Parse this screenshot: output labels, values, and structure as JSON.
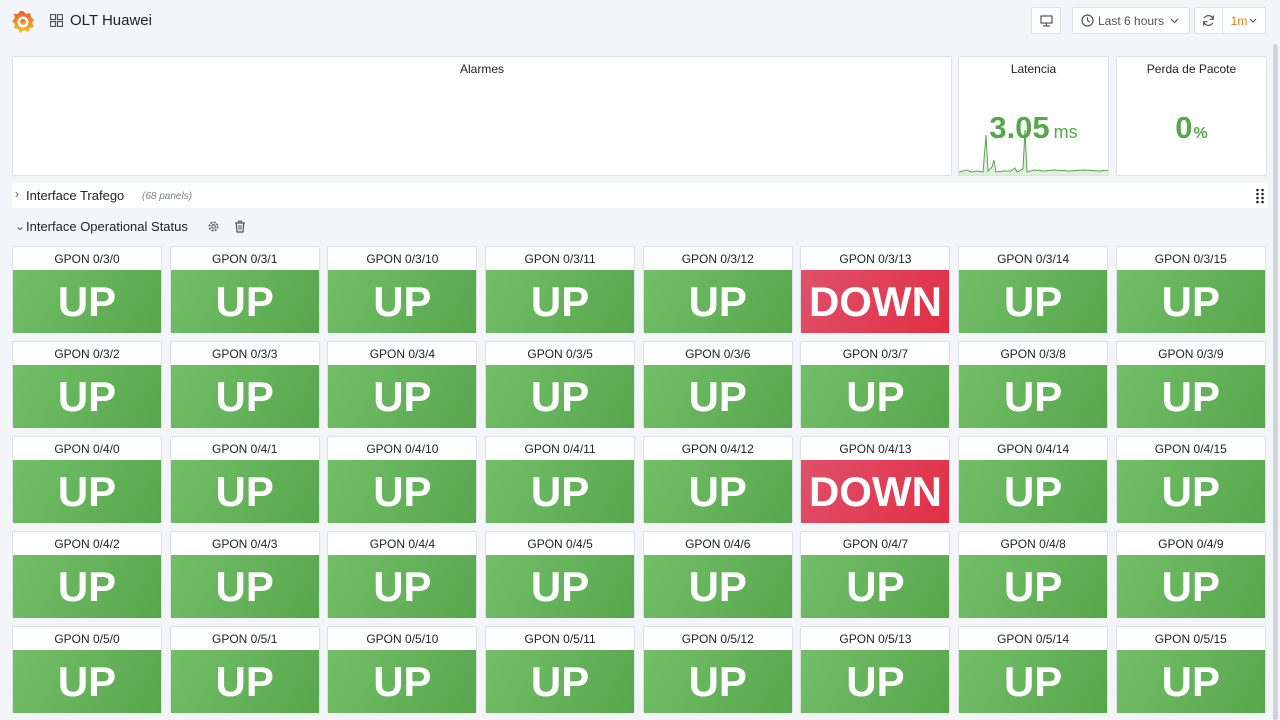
{
  "header": {
    "title": "OLT Huawei",
    "time_range_label": "Last 6 hours",
    "refresh_interval": "1m"
  },
  "panels": {
    "alarmes": {
      "title": "Alarmes"
    },
    "latencia": {
      "title": "Latencia",
      "value": "3.05",
      "unit": "ms"
    },
    "perda": {
      "title": "Perda de Pacote",
      "value": "0",
      "unit": "%"
    }
  },
  "rows": {
    "trafego": {
      "title": "Interface Trafego",
      "count": "(68 panels)"
    },
    "status": {
      "title": "Interface Operational Status"
    }
  },
  "tiles": [
    {
      "name": "GPON 0/3/0",
      "status": "UP"
    },
    {
      "name": "GPON 0/3/1",
      "status": "UP"
    },
    {
      "name": "GPON 0/3/10",
      "status": "UP"
    },
    {
      "name": "GPON 0/3/11",
      "status": "UP"
    },
    {
      "name": "GPON 0/3/12",
      "status": "UP"
    },
    {
      "name": "GPON 0/3/13",
      "status": "DOWN"
    },
    {
      "name": "GPON 0/3/14",
      "status": "UP"
    },
    {
      "name": "GPON 0/3/15",
      "status": "UP"
    },
    {
      "name": "GPON 0/3/2",
      "status": "UP"
    },
    {
      "name": "GPON 0/3/3",
      "status": "UP"
    },
    {
      "name": "GPON 0/3/4",
      "status": "UP"
    },
    {
      "name": "GPON 0/3/5",
      "status": "UP"
    },
    {
      "name": "GPON 0/3/6",
      "status": "UP"
    },
    {
      "name": "GPON 0/3/7",
      "status": "UP"
    },
    {
      "name": "GPON 0/3/8",
      "status": "UP"
    },
    {
      "name": "GPON 0/3/9",
      "status": "UP"
    },
    {
      "name": "GPON 0/4/0",
      "status": "UP"
    },
    {
      "name": "GPON 0/4/1",
      "status": "UP"
    },
    {
      "name": "GPON 0/4/10",
      "status": "UP"
    },
    {
      "name": "GPON 0/4/11",
      "status": "UP"
    },
    {
      "name": "GPON 0/4/12",
      "status": "UP"
    },
    {
      "name": "GPON 0/4/13",
      "status": "DOWN"
    },
    {
      "name": "GPON 0/4/14",
      "status": "UP"
    },
    {
      "name": "GPON 0/4/15",
      "status": "UP"
    },
    {
      "name": "GPON 0/4/2",
      "status": "UP"
    },
    {
      "name": "GPON 0/4/3",
      "status": "UP"
    },
    {
      "name": "GPON 0/4/4",
      "status": "UP"
    },
    {
      "name": "GPON 0/4/5",
      "status": "UP"
    },
    {
      "name": "GPON 0/4/6",
      "status": "UP"
    },
    {
      "name": "GPON 0/4/7",
      "status": "UP"
    },
    {
      "name": "GPON 0/4/8",
      "status": "UP"
    },
    {
      "name": "GPON 0/4/9",
      "status": "UP"
    },
    {
      "name": "GPON 0/5/0",
      "status": "UP"
    },
    {
      "name": "GPON 0/5/1",
      "status": "UP"
    },
    {
      "name": "GPON 0/5/10",
      "status": "UP"
    },
    {
      "name": "GPON 0/5/11",
      "status": "UP"
    },
    {
      "name": "GPON 0/5/12",
      "status": "UP"
    },
    {
      "name": "GPON 0/5/13",
      "status": "UP"
    },
    {
      "name": "GPON 0/5/14",
      "status": "UP"
    },
    {
      "name": "GPON 0/5/15",
      "status": "UP"
    }
  ],
  "colors": {
    "up": "#56a64b",
    "down": "#e02f44",
    "refresh_accent": "#eb7b18"
  }
}
